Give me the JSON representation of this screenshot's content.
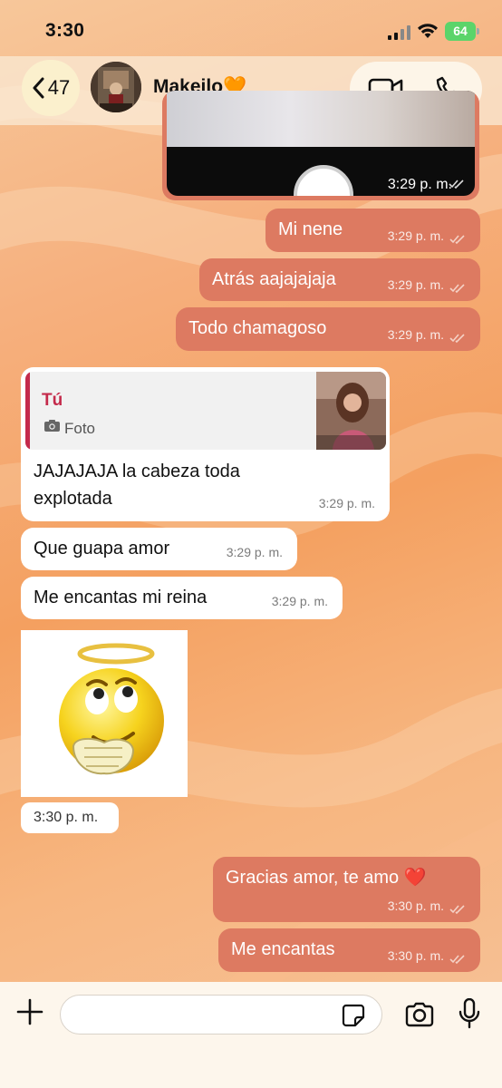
{
  "status_bar": {
    "time": "3:30",
    "battery": "64"
  },
  "header": {
    "back_count": "47",
    "contact_name": "Makeilo🧡"
  },
  "messages": [
    {
      "type": "photo",
      "direction": "out",
      "time": "3:29 p. m."
    },
    {
      "type": "text",
      "direction": "out",
      "text": "Mi nene",
      "time": "3:29 p. m."
    },
    {
      "type": "text",
      "direction": "out",
      "text": "Atrás aajajajaja",
      "time": "3:29 p. m."
    },
    {
      "type": "text",
      "direction": "out",
      "text": "Todo chamagoso",
      "time": "3:29 p. m."
    },
    {
      "type": "reply",
      "direction": "in",
      "quoted_author": "Tú",
      "quoted_kind": "Foto",
      "text": "JAJAJAJA la cabeza toda explotada",
      "time": "3:29 p. m."
    },
    {
      "type": "text",
      "direction": "in",
      "text": "Que guapa amor",
      "time": "3:29 p. m."
    },
    {
      "type": "text",
      "direction": "in",
      "text": "Me encantas mi reina",
      "time": "3:29 p. m."
    },
    {
      "type": "sticker",
      "direction": "in",
      "time": "3:30 p. m."
    },
    {
      "type": "text",
      "direction": "out",
      "text": "Gracias amor, te amo ❤️",
      "time": "3:30 p. m."
    },
    {
      "type": "text",
      "direction": "out",
      "text": "Me encantas",
      "time": "3:30 p. m."
    }
  ],
  "colors": {
    "outgoing_bubble": "#dd7a61",
    "incoming_bubble": "#ffffff",
    "reply_accent": "#c42a4b"
  },
  "icons": [
    "back-chevron-icon",
    "video-call-icon",
    "phone-icon",
    "plus-icon",
    "sticker-icon",
    "camera-icon",
    "microphone-icon"
  ]
}
